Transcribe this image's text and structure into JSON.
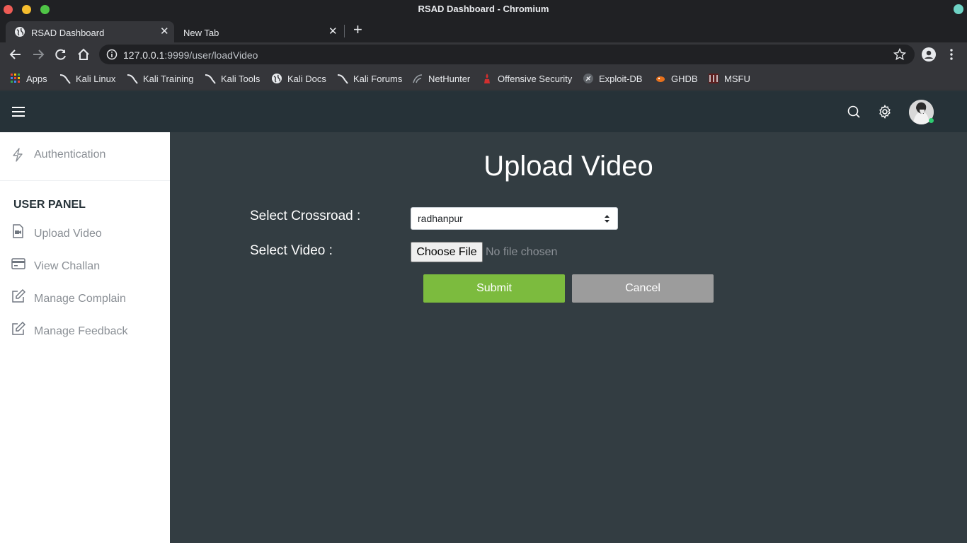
{
  "window": {
    "title": "RSAD Dashboard - Chromium"
  },
  "tabs": [
    {
      "label": "RSAD Dashboard",
      "active": true
    },
    {
      "label": "New Tab",
      "active": false
    }
  ],
  "address_bar": {
    "host": "127.0.0.1",
    "path": ":9999/user/loadVideo"
  },
  "bookmarks": [
    {
      "label": "Apps",
      "icon": "apps-grid-icon"
    },
    {
      "label": "Kali Linux",
      "icon": "kali-dragon-icon"
    },
    {
      "label": "Kali Training",
      "icon": "kali-dragon-icon"
    },
    {
      "label": "Kali Tools",
      "icon": "kali-dragon-icon"
    },
    {
      "label": "Kali Docs",
      "icon": "globe-icon"
    },
    {
      "label": "Kali Forums",
      "icon": "kali-dragon-icon"
    },
    {
      "label": "NetHunter",
      "icon": "nethunter-icon"
    },
    {
      "label": "Offensive Security",
      "icon": "offsec-icon"
    },
    {
      "label": "Exploit-DB",
      "icon": "exploitdb-icon"
    },
    {
      "label": "GHDB",
      "icon": "ghdb-icon"
    },
    {
      "label": "MSFU",
      "icon": "msfu-icon"
    }
  ],
  "sidebar": {
    "top_item": {
      "label": "Authentication",
      "icon": "bolt-icon"
    },
    "section_heading": "USER PANEL",
    "items": [
      {
        "label": "Upload Video",
        "icon": "video-file-icon"
      },
      {
        "label": "View Challan",
        "icon": "credit-card-icon"
      },
      {
        "label": "Manage Complain",
        "icon": "edit-icon"
      },
      {
        "label": "Manage Feedback",
        "icon": "edit-icon"
      }
    ]
  },
  "main": {
    "title": "Upload Video",
    "crossroad_label": "Select Crossroad :",
    "crossroad_value": "radhanpur",
    "video_label": "Select Video :",
    "file_button": "Choose File",
    "file_status": "No file chosen",
    "submit_label": "Submit",
    "cancel_label": "Cancel"
  },
  "colors": {
    "header_bg": "#263238",
    "content_bg": "#333d42",
    "submit_bg": "#7cbb3e",
    "cancel_bg": "#9c9c9c"
  }
}
